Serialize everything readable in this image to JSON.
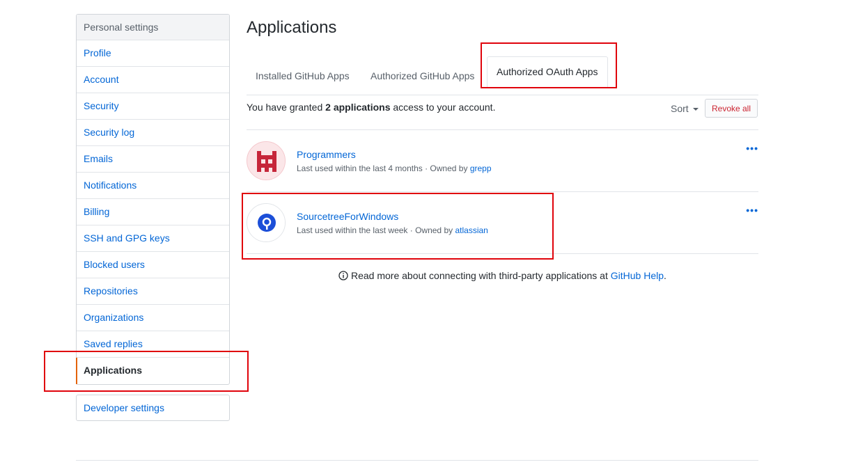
{
  "sidebar": {
    "header": "Personal settings",
    "items": [
      {
        "label": "Profile"
      },
      {
        "label": "Account"
      },
      {
        "label": "Security"
      },
      {
        "label": "Security log"
      },
      {
        "label": "Emails"
      },
      {
        "label": "Notifications"
      },
      {
        "label": "Billing"
      },
      {
        "label": "SSH and GPG keys"
      },
      {
        "label": "Blocked users"
      },
      {
        "label": "Repositories"
      },
      {
        "label": "Organizations"
      },
      {
        "label": "Saved replies"
      },
      {
        "label": "Applications",
        "active": true
      }
    ],
    "developer_settings": "Developer settings"
  },
  "main": {
    "title": "Applications",
    "tabs": [
      {
        "label": "Installed GitHub Apps"
      },
      {
        "label": "Authorized GitHub Apps"
      },
      {
        "label": "Authorized OAuth Apps",
        "selected": true
      }
    ],
    "summary": {
      "prefix": "You have granted",
      "count": "2 applications",
      "suffix": "access to your account."
    },
    "sort_label": "Sort",
    "revoke_all_label": "Revoke all",
    "apps": [
      {
        "name": "Programmers",
        "meta_prefix": "Last used within the last 4 months · Owned by",
        "owner": "grepp",
        "icon": "space-invader-icon"
      },
      {
        "name": "SourcetreeForWindows",
        "meta_prefix": "Last used within the last week · Owned by",
        "owner": "atlassian",
        "icon": "sourcetree-icon"
      }
    ],
    "help": {
      "text": "Read more about connecting with third-party applications at",
      "link": "GitHub Help",
      "suffix": "."
    }
  },
  "colors": {
    "link": "#0366d6",
    "highlight": "#e0030b",
    "active_marker": "#e36209",
    "danger": "#cb2431"
  }
}
